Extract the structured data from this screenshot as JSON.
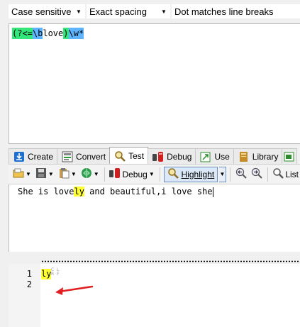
{
  "options": {
    "case": "Case sensitive",
    "spacing": "Exact spacing",
    "dot": "Dot matches line breaks"
  },
  "regex": {
    "tokens": [
      {
        "text": "(?<=",
        "kind": "green"
      },
      {
        "text": "\\b",
        "kind": "blue"
      },
      {
        "text": "love",
        "kind": "plain"
      },
      {
        "text": ")",
        "kind": "green"
      },
      {
        "text": "\\w*",
        "kind": "blue"
      }
    ]
  },
  "tabs": [
    {
      "label": "Create",
      "icon": "download-icon"
    },
    {
      "label": "Convert",
      "icon": "convert-icon"
    },
    {
      "label": "Test",
      "icon": "magnifier-icon"
    },
    {
      "label": "Debug",
      "icon": "bug-icon"
    },
    {
      "label": "Use",
      "icon": "use-icon"
    },
    {
      "label": "Library",
      "icon": "library-icon"
    }
  ],
  "toolbar": {
    "debug_label": "Debug",
    "highlight_label": "Highlight",
    "list_label": "List"
  },
  "subject": {
    "before": "She is love",
    "match": "ly",
    "after": " and beautiful,i love she"
  },
  "results": {
    "line1_num": "1",
    "line2_num": "2",
    "line1_match": "ly",
    "crlf_top": "C L",
    "crlf_bottom": "R F"
  },
  "colors": {
    "green_token": "#33e67a",
    "blue_token": "#5fb4ff",
    "match_highlight": "#ffff33",
    "annotation_arrow": "#e02020"
  }
}
